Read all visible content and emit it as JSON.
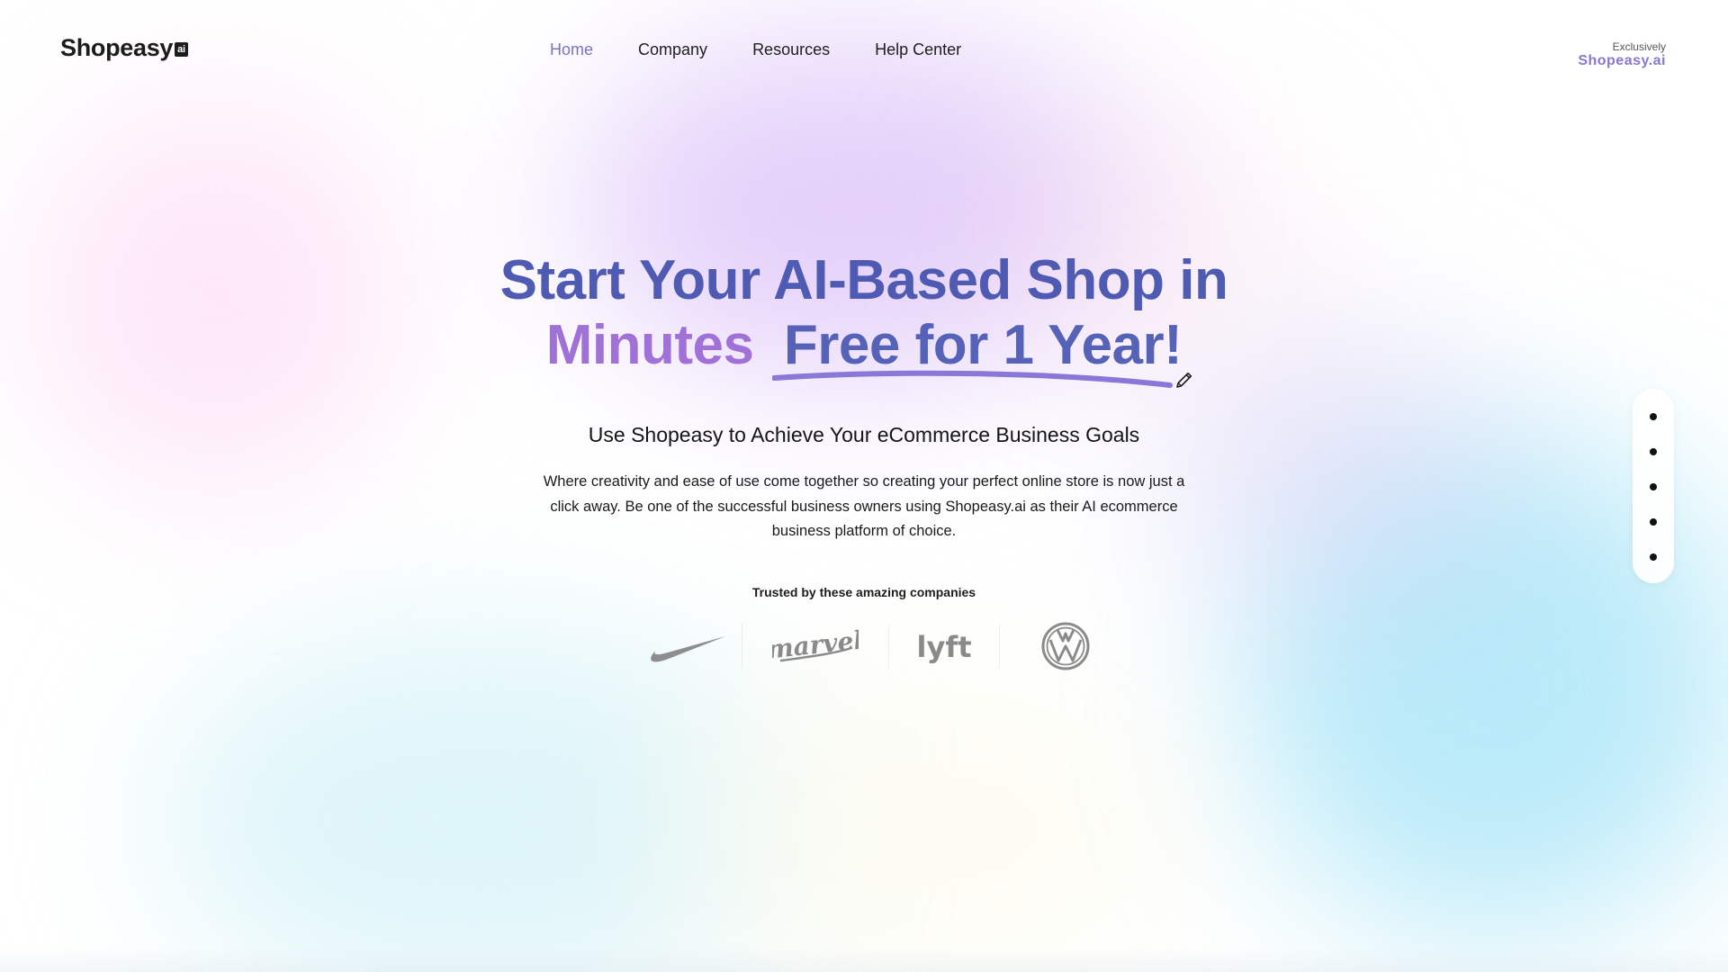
{
  "header": {
    "logo_text": "Shopeasy",
    "logo_badge": "ai",
    "nav": [
      {
        "label": "Home",
        "active": true
      },
      {
        "label": "Company",
        "active": false
      },
      {
        "label": "Resources",
        "active": false
      },
      {
        "label": "Help Center",
        "active": false
      }
    ],
    "exclusive_label": "Exclusively",
    "exclusive_brand": "Shopeasy.ai"
  },
  "hero": {
    "headline_line1": "Start Your AI-Based Shop in",
    "headline_minutes": "Minutes",
    "headline_free": "Free for 1 Year!",
    "subheadline": "Use Shopeasy to Achieve Your eCommerce Business Goals",
    "description": "Where creativity and ease of use come together so creating your perfect online store is now just a click away. Be one of the successful business owners using Shopeasy.ai as their AI ecommerce business platform of choice.",
    "edit_icon": "pencil-icon"
  },
  "trusted": {
    "label": "Trusted by these amazing companies",
    "logos": [
      "nike-logo",
      "marvel-logo",
      "lyft-logo",
      "volkswagen-logo"
    ],
    "logo_marvel_text": "marvel",
    "logo_lyft_text": "lyft"
  },
  "section_dots": {
    "count": 5
  },
  "colors": {
    "headline": "#4f5bb2",
    "minutes": "#a072d8",
    "underline": "#8a78d8",
    "active_nav": "#7b74c4",
    "brand": "#8a78d2"
  }
}
